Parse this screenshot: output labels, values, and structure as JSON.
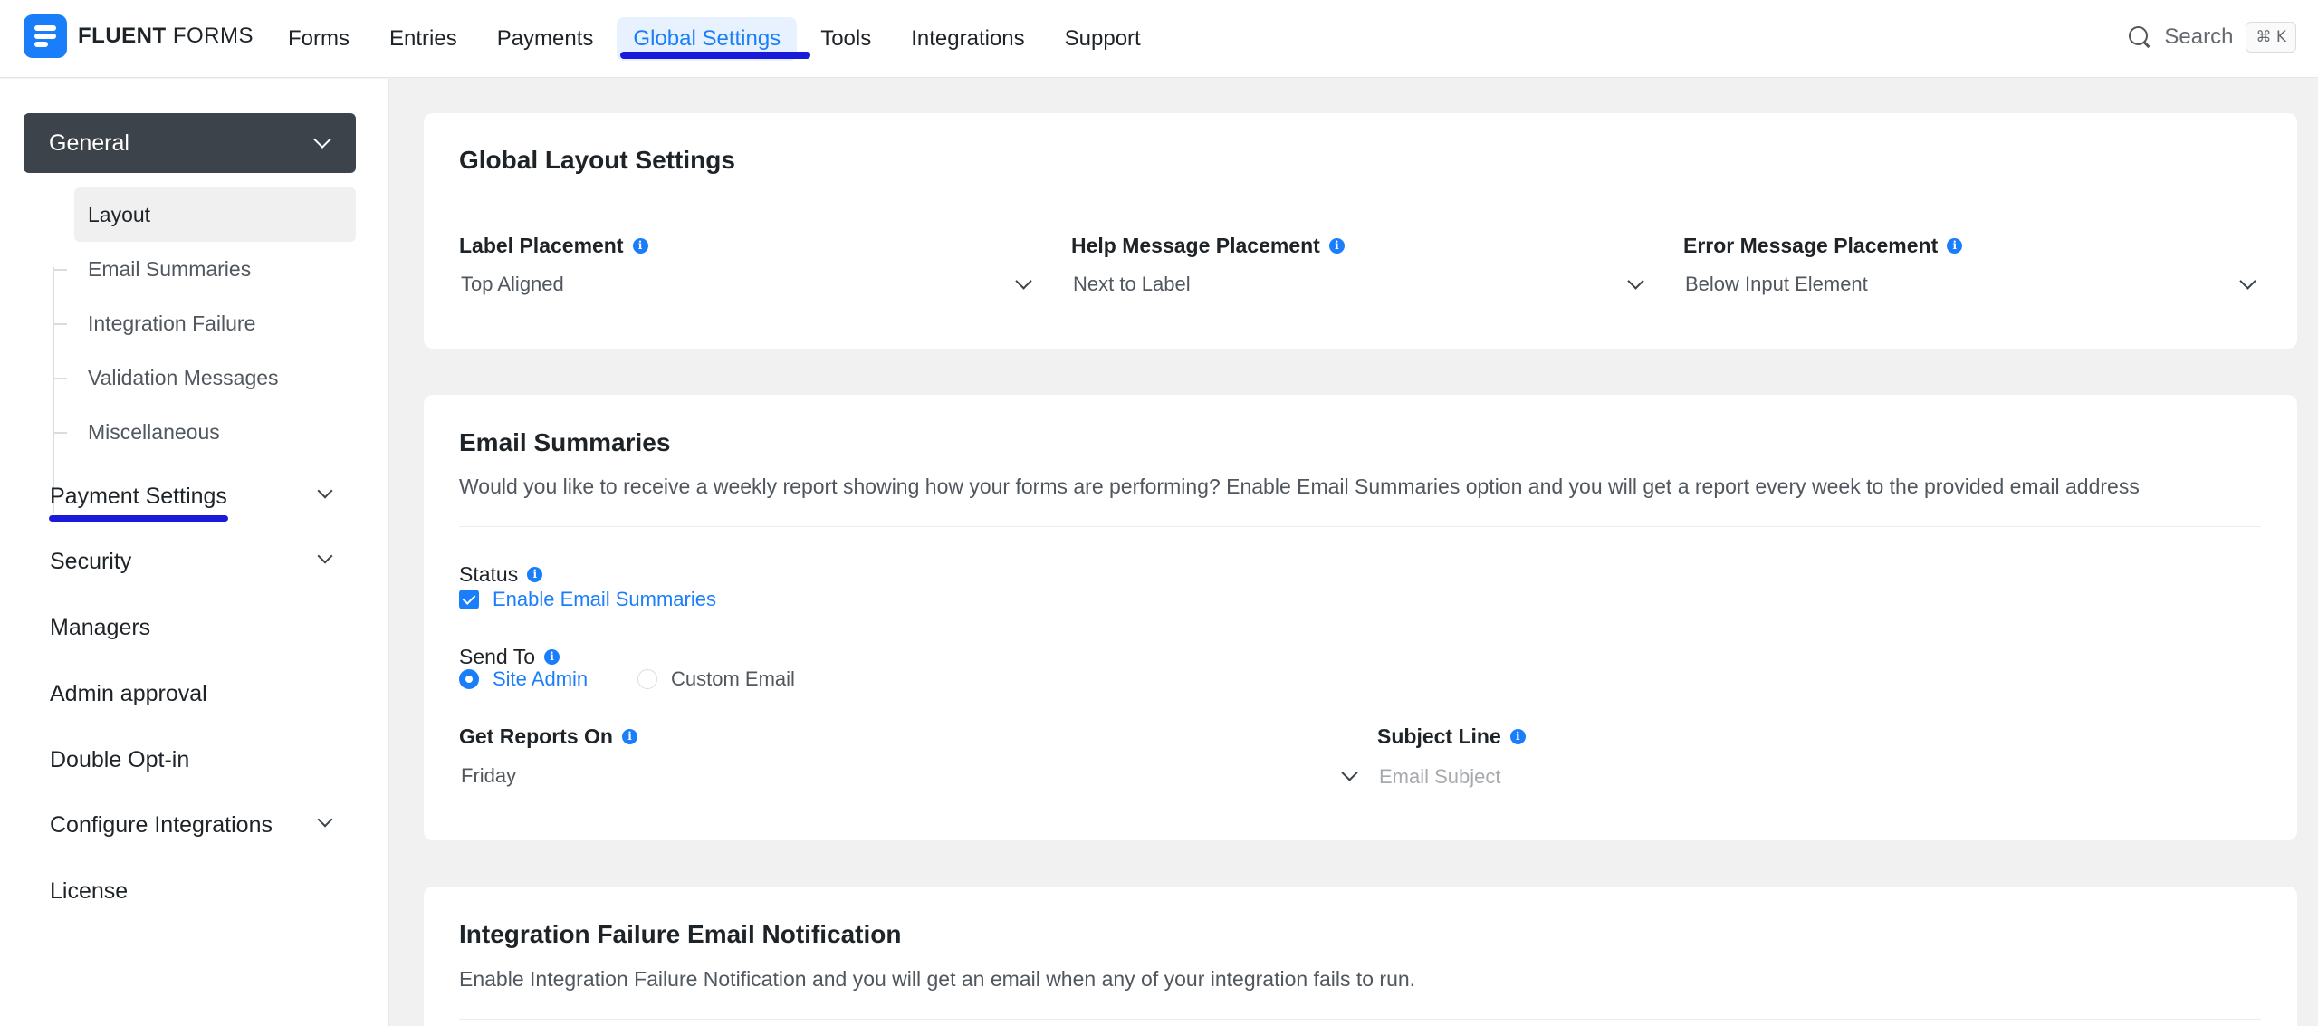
{
  "brand": {
    "name_bold": "FLUENT",
    "name_light": "FORMS"
  },
  "nav": {
    "items": [
      "Forms",
      "Entries",
      "Payments",
      "Global Settings",
      "Tools",
      "Integrations",
      "Support"
    ],
    "active": "Global Settings"
  },
  "search": {
    "label": "Search",
    "shortcut": "⌘ K"
  },
  "sidebar": {
    "general": "General",
    "general_sub": [
      "Layout",
      "Email Summaries",
      "Integration Failure",
      "Validation Messages",
      "Miscellaneous"
    ],
    "active_sub": "Layout",
    "items": [
      "Payment Settings",
      "Security",
      "Managers",
      "Admin approval",
      "Double Opt-in",
      "Configure Integrations",
      "License"
    ]
  },
  "layout_card": {
    "title": "Global Layout Settings",
    "label_placement": {
      "label": "Label Placement",
      "value": "Top Aligned"
    },
    "help_placement": {
      "label": "Help Message Placement",
      "value": "Next to Label"
    },
    "error_placement": {
      "label": "Error Message Placement",
      "value": "Below Input Element"
    }
  },
  "email_card": {
    "title": "Email Summaries",
    "description": "Would you like to receive a weekly report showing how your forms are performing? Enable Email Summaries option and you will get a report every week to the provided email address",
    "status_label": "Status",
    "status_option": "Enable Email Summaries",
    "status_checked": true,
    "send_to_label": "Send To",
    "send_to_options": [
      "Site Admin",
      "Custom Email"
    ],
    "send_to_selected": "Site Admin",
    "reports_label": "Get Reports On",
    "reports_value": "Friday",
    "subject_label": "Subject Line",
    "subject_placeholder": "Email Subject"
  },
  "integration_card": {
    "title": "Integration Failure Email Notification",
    "description": "Enable Integration Failure Notification and you will get an email when any of your integration fails to run."
  },
  "colors": {
    "accent": "#1a7efb",
    "annotation": "#1a1ad9",
    "sidebar_active": "#3c434a"
  }
}
